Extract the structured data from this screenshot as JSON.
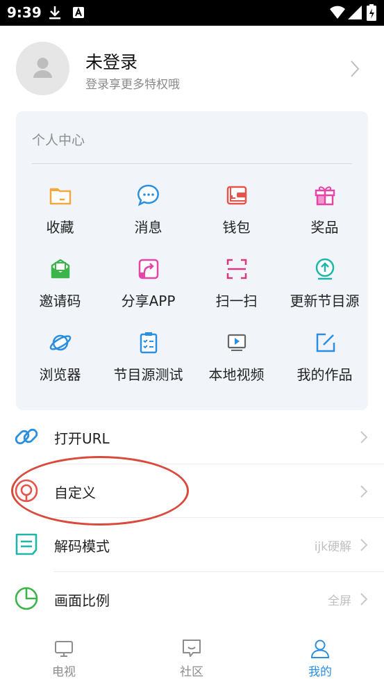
{
  "status_bar": {
    "time": "9:39"
  },
  "profile": {
    "name": "未登录",
    "subtitle": "登录享更多特权哦"
  },
  "personal_center": {
    "title": "个人中心",
    "items": [
      {
        "label": "收藏",
        "icon": "folder-icon",
        "color": "#f2a93b"
      },
      {
        "label": "消息",
        "icon": "message-icon",
        "color": "#2a8fe0"
      },
      {
        "label": "钱包",
        "icon": "wallet-icon",
        "color": "#e5534b"
      },
      {
        "label": "奖品",
        "icon": "gift-icon",
        "color": "#e546a6"
      },
      {
        "label": "邀请码",
        "icon": "envelope-icon",
        "color": "#3bb54a"
      },
      {
        "label": "分享APP",
        "icon": "share-icon",
        "color": "#e546a6"
      },
      {
        "label": "扫一扫",
        "icon": "scan-icon",
        "color": "#d8387f"
      },
      {
        "label": "更新节目源",
        "icon": "upload-icon",
        "color": "#1fb5a8"
      },
      {
        "label": "浏览器",
        "icon": "planet-icon",
        "color": "#2a8fe0"
      },
      {
        "label": "节目源测试",
        "icon": "checklist-icon",
        "color": "#2a8fe0"
      },
      {
        "label": "本地视频",
        "icon": "video-icon",
        "color": "#666666"
      },
      {
        "label": "我的作品",
        "icon": "edit-icon",
        "color": "#2a8fe0"
      }
    ]
  },
  "menu": {
    "open_url": {
      "label": "打开URL"
    },
    "custom": {
      "label": "自定义"
    },
    "decode_mode": {
      "label": "解码模式",
      "value": "ijk硬解"
    },
    "aspect_ratio": {
      "label": "画面比例",
      "value": "全屏"
    }
  },
  "tabbar": {
    "tabs": [
      {
        "label": "电视"
      },
      {
        "label": "社区"
      },
      {
        "label": "我的",
        "active": true
      }
    ],
    "active_color": "#2a8fe0"
  }
}
